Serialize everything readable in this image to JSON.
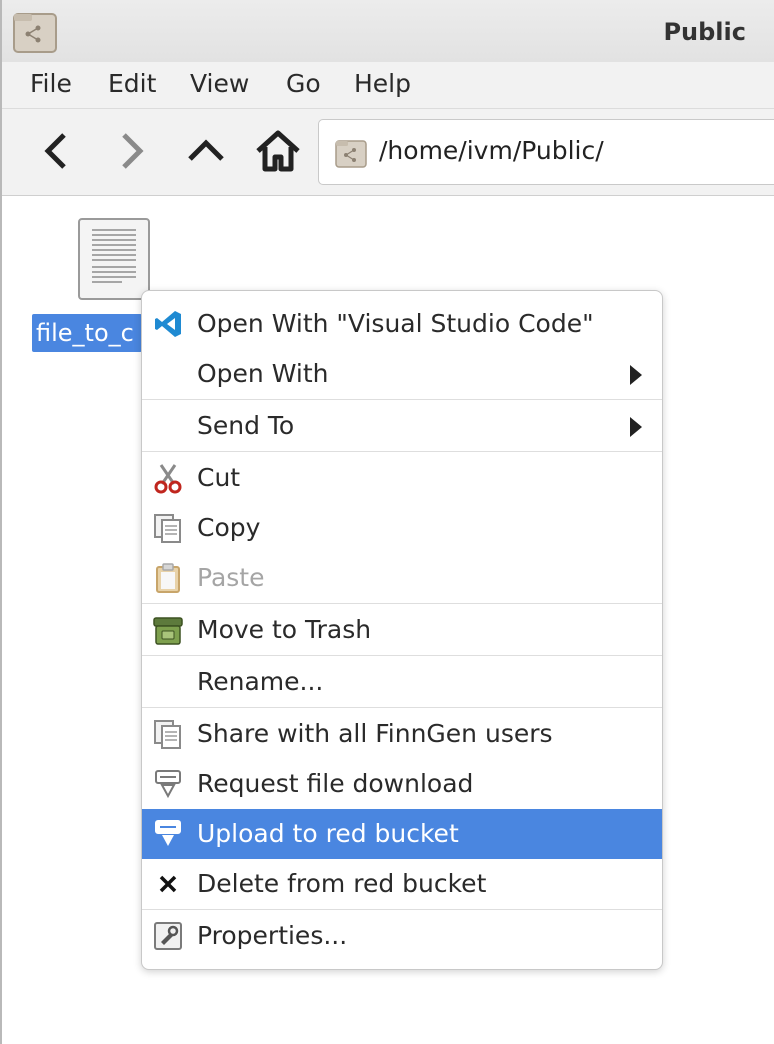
{
  "window": {
    "title": "Public"
  },
  "menubar": {
    "items": [
      "File",
      "Edit",
      "View",
      "Go",
      "Help"
    ]
  },
  "toolbar": {
    "back_icon": "back-arrow-icon",
    "forward_icon": "forward-arrow-icon",
    "up_icon": "up-arrow-icon",
    "home_icon": "home-icon",
    "path": "/home/ivm/Public/"
  },
  "files": [
    {
      "label": "file_to_c",
      "icon": "text-document-icon",
      "selected": true
    }
  ],
  "context_menu": {
    "items": [
      {
        "label": "Open With \"Visual Studio Code\"",
        "icon": "vscode-icon"
      },
      {
        "label": "Open With",
        "submenu": true
      },
      {
        "label": "Send To",
        "submenu": true
      },
      {
        "label": "Cut",
        "icon": "scissors-icon"
      },
      {
        "label": "Copy",
        "icon": "copy-icon"
      },
      {
        "label": "Paste",
        "icon": "paste-icon",
        "disabled": true
      },
      {
        "label": "Move to Trash",
        "icon": "trash-icon"
      },
      {
        "label": "Rename..."
      },
      {
        "label": "Share with all FinnGen users",
        "icon": "share-icon"
      },
      {
        "label": "Request file download",
        "icon": "download-request-icon"
      },
      {
        "label": "Upload to red bucket",
        "icon": "upload-icon",
        "highlighted": true
      },
      {
        "label": "Delete from red bucket",
        "icon": "x-icon"
      },
      {
        "label": "Properties...",
        "icon": "properties-icon"
      }
    ]
  },
  "colors": {
    "selection": "#4a86e0",
    "disabled_text": "#a5a5a5"
  }
}
